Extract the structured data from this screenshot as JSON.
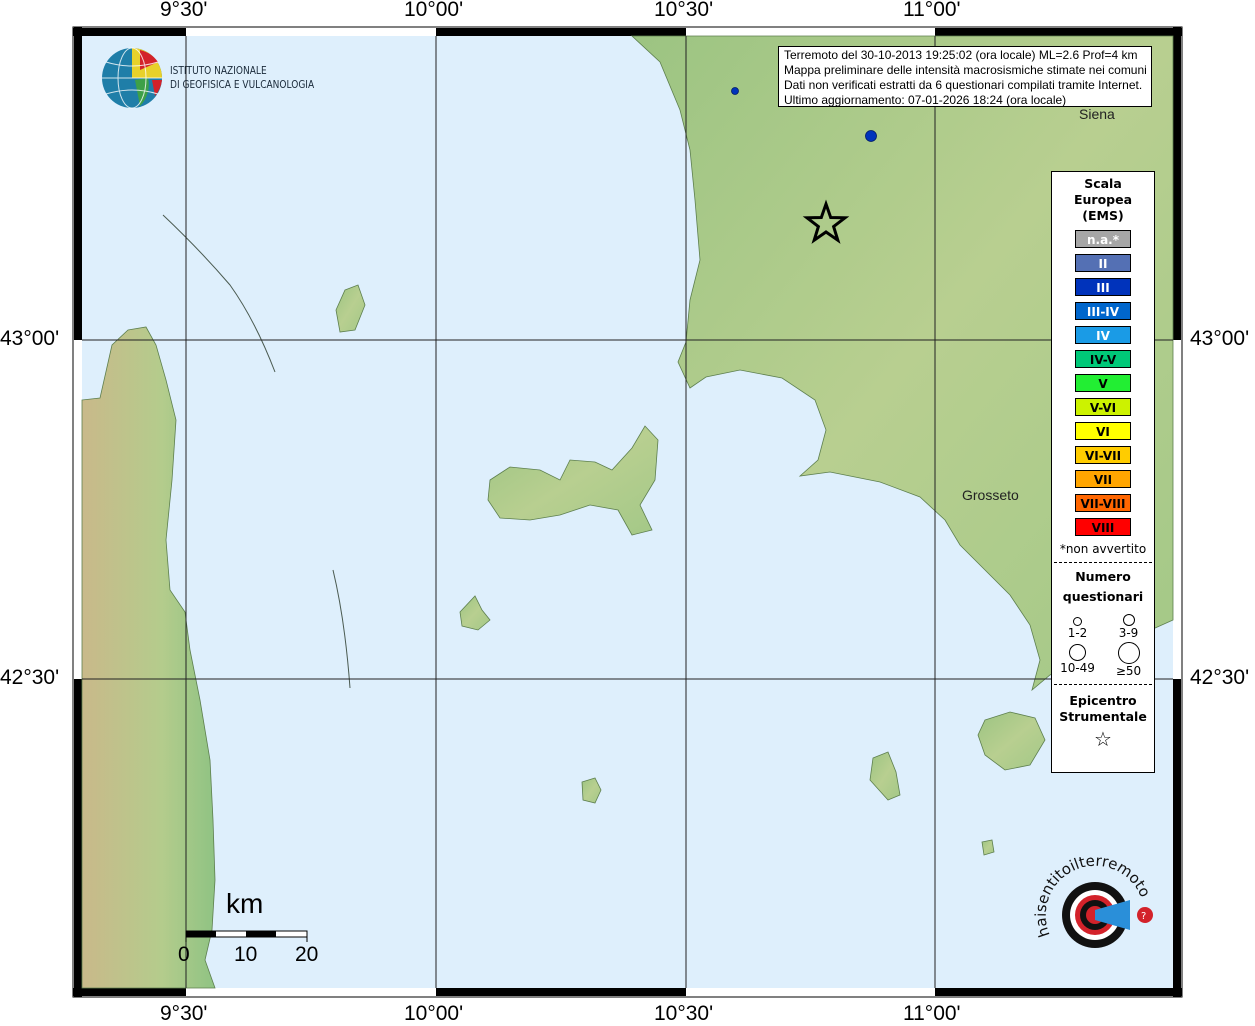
{
  "axes": {
    "lon_labels": [
      "9°30'",
      "10°00'",
      "10°30'",
      "11°00'"
    ],
    "lat_labels": [
      "43°00'",
      "42°30'"
    ]
  },
  "info_box": {
    "line1": "Terremoto del 30-10-2013 19:25:02 (ora locale) ML=2.6 Prof=4 km",
    "line2": "Mappa preliminare delle intensità macrosismiche stimate nei comuni",
    "line3": "Dati non verificati estratti da 6 questionari compilati tramite Internet.",
    "line4": "Ultimo aggiornamento: 07-01-2026 18:24 (ora locale)"
  },
  "logo_ingv": {
    "line1": "ISTITUTO NAZIONALE",
    "line2": "DI GEOFISICA E VULCANOLOGIA"
  },
  "logo_hsit": {
    "text": "www.haisentitoilterremoto.it"
  },
  "places": {
    "siena": "Siena",
    "grosseto": "Grosseto"
  },
  "scale_bar": {
    "unit": "km",
    "ticks": [
      "0",
      "10",
      "20"
    ]
  },
  "legend": {
    "title_line1": "Scala",
    "title_line2": "Europea",
    "title_line3": "(EMS)",
    "classes": [
      {
        "label": "n.a.*",
        "color": "#a6a6a6",
        "text_color": "#ffffff"
      },
      {
        "label": "II",
        "color": "#5470b4",
        "text_color": "#ffffff"
      },
      {
        "label": "III",
        "color": "#0033bb",
        "text_color": "#ffffff"
      },
      {
        "label": "III-IV",
        "color": "#0066cc",
        "text_color": "#ffffff"
      },
      {
        "label": "IV",
        "color": "#1a9be6",
        "text_color": "#ffffff"
      },
      {
        "label": "IV-V",
        "color": "#00c878",
        "text_color": "#000000"
      },
      {
        "label": "V",
        "color": "#22ee33",
        "text_color": "#000000"
      },
      {
        "label": "V-VI",
        "color": "#ccf200",
        "text_color": "#000000"
      },
      {
        "label": "VI",
        "color": "#ffff00",
        "text_color": "#000000"
      },
      {
        "label": "VI-VII",
        "color": "#ffcc00",
        "text_color": "#000000"
      },
      {
        "label": "VII",
        "color": "#ffa500",
        "text_color": "#000000"
      },
      {
        "label": "VII-VIII",
        "color": "#ff6600",
        "text_color": "#000000"
      },
      {
        "label": "VIII",
        "color": "#ff0000",
        "text_color": "#000000"
      }
    ],
    "na_note": "*non avvertito",
    "count_title_line1": "Numero",
    "count_title_line2": "questionari",
    "count_classes": [
      "1-2",
      "3-9",
      "10-49",
      "≥50"
    ],
    "epicenter_line1": "Epicentro",
    "epicenter_line2": "Strumentale"
  },
  "observations": [
    {
      "intensity": "III",
      "questionnaires": "1-2"
    },
    {
      "intensity": "III",
      "questionnaires": "3-9"
    }
  ],
  "colors": {
    "sea": "#dcefff",
    "land": "#a9c98a",
    "frame": "#000000"
  }
}
